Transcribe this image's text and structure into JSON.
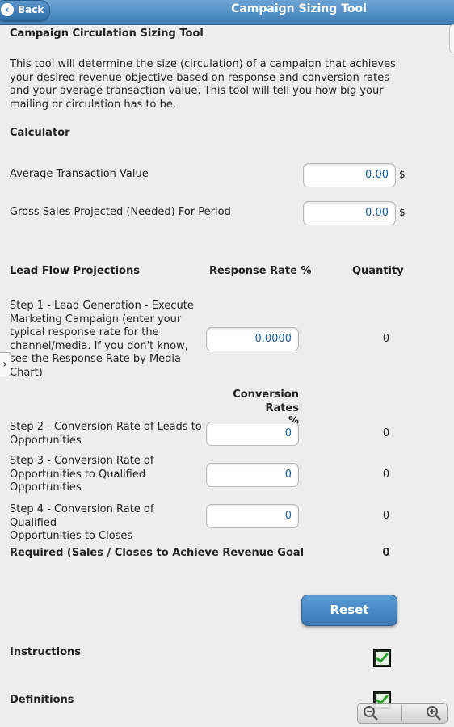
{
  "header": {
    "back_label": "Back",
    "title": "Campaign Sizing Tool"
  },
  "content": {
    "heading": "Campaign Circulation Sizing Tool",
    "intro": [
      "This tool will determine the size (circulation) of a campaign that achieves",
      "your desired revenue objective based on response and conversion rates",
      "and your average transaction value. This tool will tell you how big your",
      "mailing or circulation has to be."
    ],
    "calculator_label": "Calculator",
    "avg_label": "Average Transaction Value",
    "avg_value": "0.00",
    "gross_label": "Gross Sales Projected (Needed) For Period",
    "gross_value": "0.00",
    "currency": "$",
    "lead_flow_header": "Lead Flow Projections",
    "response_rate_header": "Response Rate %",
    "quantity_header": "Quantity",
    "step1": [
      "Step 1 - Lead Generation - Execute",
      "Marketing Campaign (enter your",
      "typical response rate for the",
      "channel/media. If you don't know,",
      "see the Response Rate by Media",
      "Chart)"
    ],
    "step1_value": "0.0000",
    "step1_qty": "0",
    "conversion_header_1": "Conversion Rates",
    "conversion_header_2": "%",
    "step2": [
      "Step 2 - Conversion Rate of Leads to",
      "Opportunities"
    ],
    "step2_value": "0",
    "step2_qty": "0",
    "step3": [
      "Step 3 - Conversion Rate of",
      "Opportunities to Qualified",
      "Opportunities"
    ],
    "step3_value": "0",
    "step3_qty": "0",
    "step4": [
      "Step 4 - Conversion Rate of Qualified",
      "Opportunities to Closes"
    ],
    "step4_value": "0",
    "step4_qty": "0",
    "required_label": "Required (Sales / Closes to Achieve Revenue Goal",
    "required_value": "0",
    "reset_label": "Reset",
    "instructions_label": "Instructions",
    "definitions_label": "Definitions"
  },
  "icons": {
    "back": "chevron-left-icon",
    "side_tab": "chevron-right-icon",
    "check": "checkmark-icon",
    "zoom_out": "zoom-out-icon",
    "zoom_in": "zoom-in-icon"
  },
  "colors": {
    "header_blue": "#3b7cb7",
    "input_text": "#1f5e9c",
    "check_green": "#2e9e2e"
  }
}
